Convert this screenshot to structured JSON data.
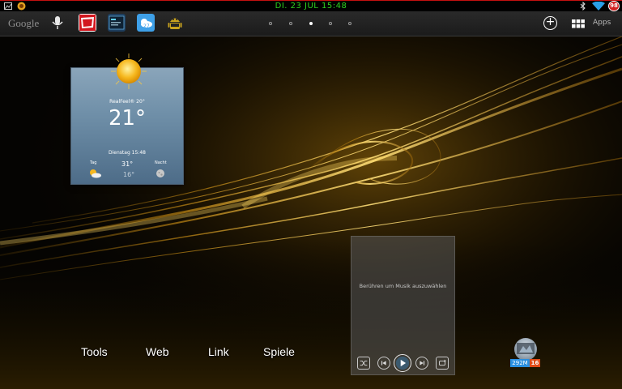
{
  "status_bar": {
    "clock": "DI. 23 JUL 15:48",
    "battery": "98",
    "icons": [
      "screenshot-icon",
      "notification-icon",
      "bluetooth-icon",
      "wifi-icon"
    ]
  },
  "top_bar": {
    "search_label": "Google",
    "apps_label": "Apps",
    "app_shortcuts": [
      "voice-search-icon",
      "bild-app-icon",
      "dashboard-app-icon",
      "weather-app-icon",
      "android-app-icon"
    ],
    "page_count": 5,
    "active_page": 3
  },
  "weather": {
    "realfeel": "RealFeel® 20°",
    "temperature": "21°",
    "datetime": "Dienstag 15:48",
    "day_label": "Tag",
    "night_label": "Nacht",
    "high": "31°",
    "low": "16°"
  },
  "music": {
    "hint": "Berühren um Musik auszuwählen",
    "controls": [
      "shuffle",
      "previous",
      "play",
      "next",
      "repeat"
    ]
  },
  "folders": [
    "Tools",
    "Web",
    "Link",
    "Spiele"
  ],
  "ram_widget": {
    "memory": "292M",
    "count": "16"
  },
  "colors": {
    "status_clock": "#2fd11f",
    "battery_badge": "#d12020",
    "wallpaper_glow": "#e0a020"
  }
}
